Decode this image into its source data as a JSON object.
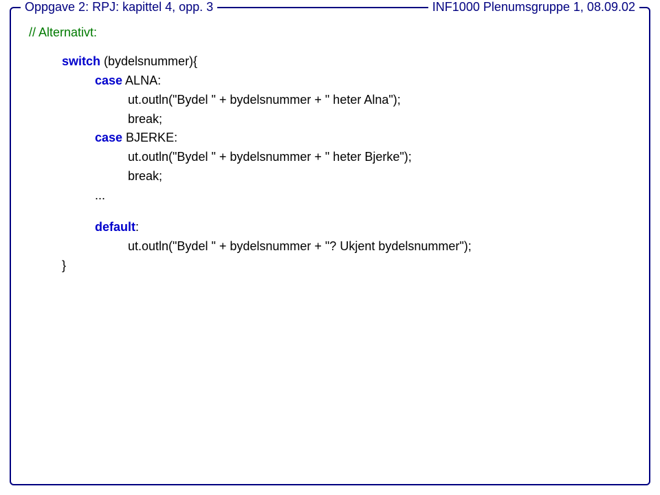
{
  "header": {
    "left": "Oppgave 2: RPJ: kapittel 4, opp. 3",
    "right": "INF1000  Plenumsgruppe 1, 08.09.02"
  },
  "code": {
    "comment": "// Alternativt:",
    "kw_switch": "switch",
    "switch_tail": " (bydelsnummer){",
    "kw_case1": "case",
    "case1_tail": " ALNA:",
    "line1": "ut.outln(\"Bydel \" + bydelsnummer + \" heter Alna\");",
    "break1": "break;",
    "kw_case2": "case",
    "case2_tail": " BJERKE:",
    "line2": "ut.outln(\"Bydel \" + bydelsnummer + \" heter Bjerke\");",
    "break2": "break;",
    "ellipsis": "...",
    "kw_default": "default",
    "default_tail": ":",
    "line3": "ut.outln(\"Bydel \" + bydelsnummer + \"? Ukjent bydelsnummer\");",
    "close": "}"
  }
}
